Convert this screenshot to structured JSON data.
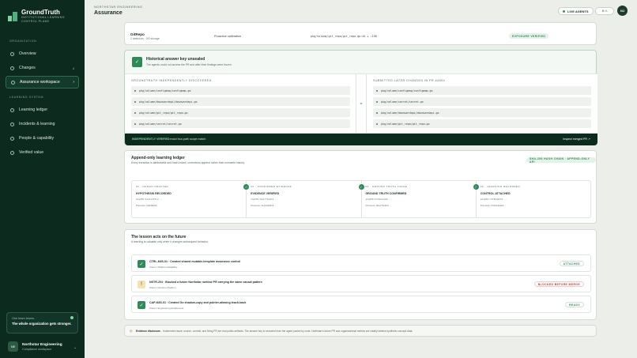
{
  "brand": {
    "name": "GroundTruth",
    "subtitle": "INSTITUTIONAL LEARNING CONTROL PLANE"
  },
  "nav": {
    "org_label": "ORGANIZATION",
    "items": [
      {
        "label": "Overview",
        "icon": "home-icon"
      },
      {
        "label": "Changes",
        "icon": "changes-icon",
        "count": "4"
      },
      {
        "label": "Assurance workspace",
        "icon": "shield-icon",
        "active": true
      }
    ],
    "learning_label": "LEARNING SYSTEM",
    "learning_items": [
      {
        "label": "Learning ledger",
        "icon": "ledger-icon"
      },
      {
        "label": "Incidents & learning",
        "icon": "incident-icon"
      },
      {
        "label": "People & capability",
        "icon": "people-icon"
      },
      {
        "label": "Verified value",
        "icon": "value-icon"
      }
    ]
  },
  "promo": {
    "kicker": "One team learns.",
    "text": "The whole organization gets stronger."
  },
  "workspace": {
    "initials": "NE",
    "name": "Northstar Engineering",
    "sub": "Compliance workspace"
  },
  "header": {
    "crumb": "NORTHSTAR ENGINEERING",
    "title": "Assurance",
    "live": "LIVE AGENTS",
    "kbd": "⌘ K",
    "avatar": "NJ"
  },
  "repo_card": {
    "name": "GitRepo",
    "meta": "2 detectors · 0/0 storage",
    "desc": "Proactive calibration",
    "path": "pkg/volume/git_repo/git_repo.go:44 + :158",
    "badge": "EXPOSURE VERIFIED"
  },
  "historical": {
    "title": "Historical answer key unsealed",
    "sub": "The agents could not access the PR and after their findings were frozen.",
    "left_label": "GROUNDTRUTH INDEPENDENTLY DISCOVERED",
    "left_paths": [
      "pkg/volume/configmap/configmap.go",
      "pkg/volume/downwardapi/downwardapi.go",
      "pkg/volume/git_repo/git_repo.go",
      "pkg/volume/secret/secret.go"
    ],
    "right_label": "SUBMITTED LATER CHANGED IN PR #4804",
    "right_paths": [
      "pkg/volume/configmap/configmap.go",
      "pkg/volume/secret/secret.go",
      "pkg/volume/downwardapi/downwardapi.go",
      "pkg/volume/git_repo/git_repo.go"
    ],
    "eq": "=",
    "footer_tag": "INDEPENDENTLY VERIFIED",
    "footer_text": "exact four-path scope match",
    "footer_link": "Inspect merged PR ↗"
  },
  "ledger": {
    "title": "Append-only learning ledger",
    "sub": "Every transition is attributable and hash-linked; corrections append rather than overwrite history.",
    "badge": "SHA-256 HASH CHAIN · APPEND-ONLY API",
    "steps": [
      {
        "num": "01",
        "kind": "HUMAN DRAFTED",
        "title": "HYPOTHESIS RECORDED",
        "hash": "sha256:4e21d4f6c2...",
        "prev": "Previous: GENESIS"
      },
      {
        "num": "02",
        "kind": "CONFIRMED EVIDENCE",
        "title": "EVIDENCE VERIFIED",
        "hash": "sha256:9a1c7fe2b4...",
        "prev": "Previous: 4e21d4f6c2..."
      },
      {
        "num": "03",
        "kind": "GROUND TRUTH JUDGE",
        "title": "GROUND TRUTH CONFIRMED",
        "hash": "sha256:b7d0e11a9c...",
        "prev": "Previous: 9a1c7fe2b4..."
      },
      {
        "num": "04",
        "kind": "LEARNING RECORDED",
        "title": "CONTROL ATTACHED",
        "hash": "sha256:c5f82a6d31...",
        "prev": "Previous: b7d0e11a9c..."
      }
    ]
  },
  "lesson": {
    "title": "The lesson acts on the future",
    "sub": "A learning is valuable only when it changes subsequent behavior.",
    "items": [
      {
        "status": "ok",
        "title": "CTRL-K8S-01 · Created shared mutable-template assurance control",
        "owner": "Owner: Platform Reliability",
        "badge": "ATTACHED",
        "badge_color": "#2f8a57"
      },
      {
        "status": "warn",
        "title": "NSTR-204 · Blocked a future Northstar runtime PR carrying the same causal pattern",
        "owner": "Owner: Runtime Platform",
        "badge": "BLOCKED BEFORE MERGE",
        "badge_color": "#c0392b"
      },
      {
        "status": "ok",
        "title": "CAP-K8S-01 · Created Go shadow-copy and pointer-aliasing teach-back",
        "owner": "Owner: Engineering Enablement",
        "badge": "READY",
        "badge_color": "#2f8a57"
      }
    ]
  },
  "disclosure": {
    "label": "Evidence disclosure.",
    "text": "Kubernetes issue, source, commit, and fixing PR are real public artifacts. The answer key is excluded from the agent packet by code. Northstar's future PR and organizational metrics are clearly labeled synthetic concept data."
  }
}
